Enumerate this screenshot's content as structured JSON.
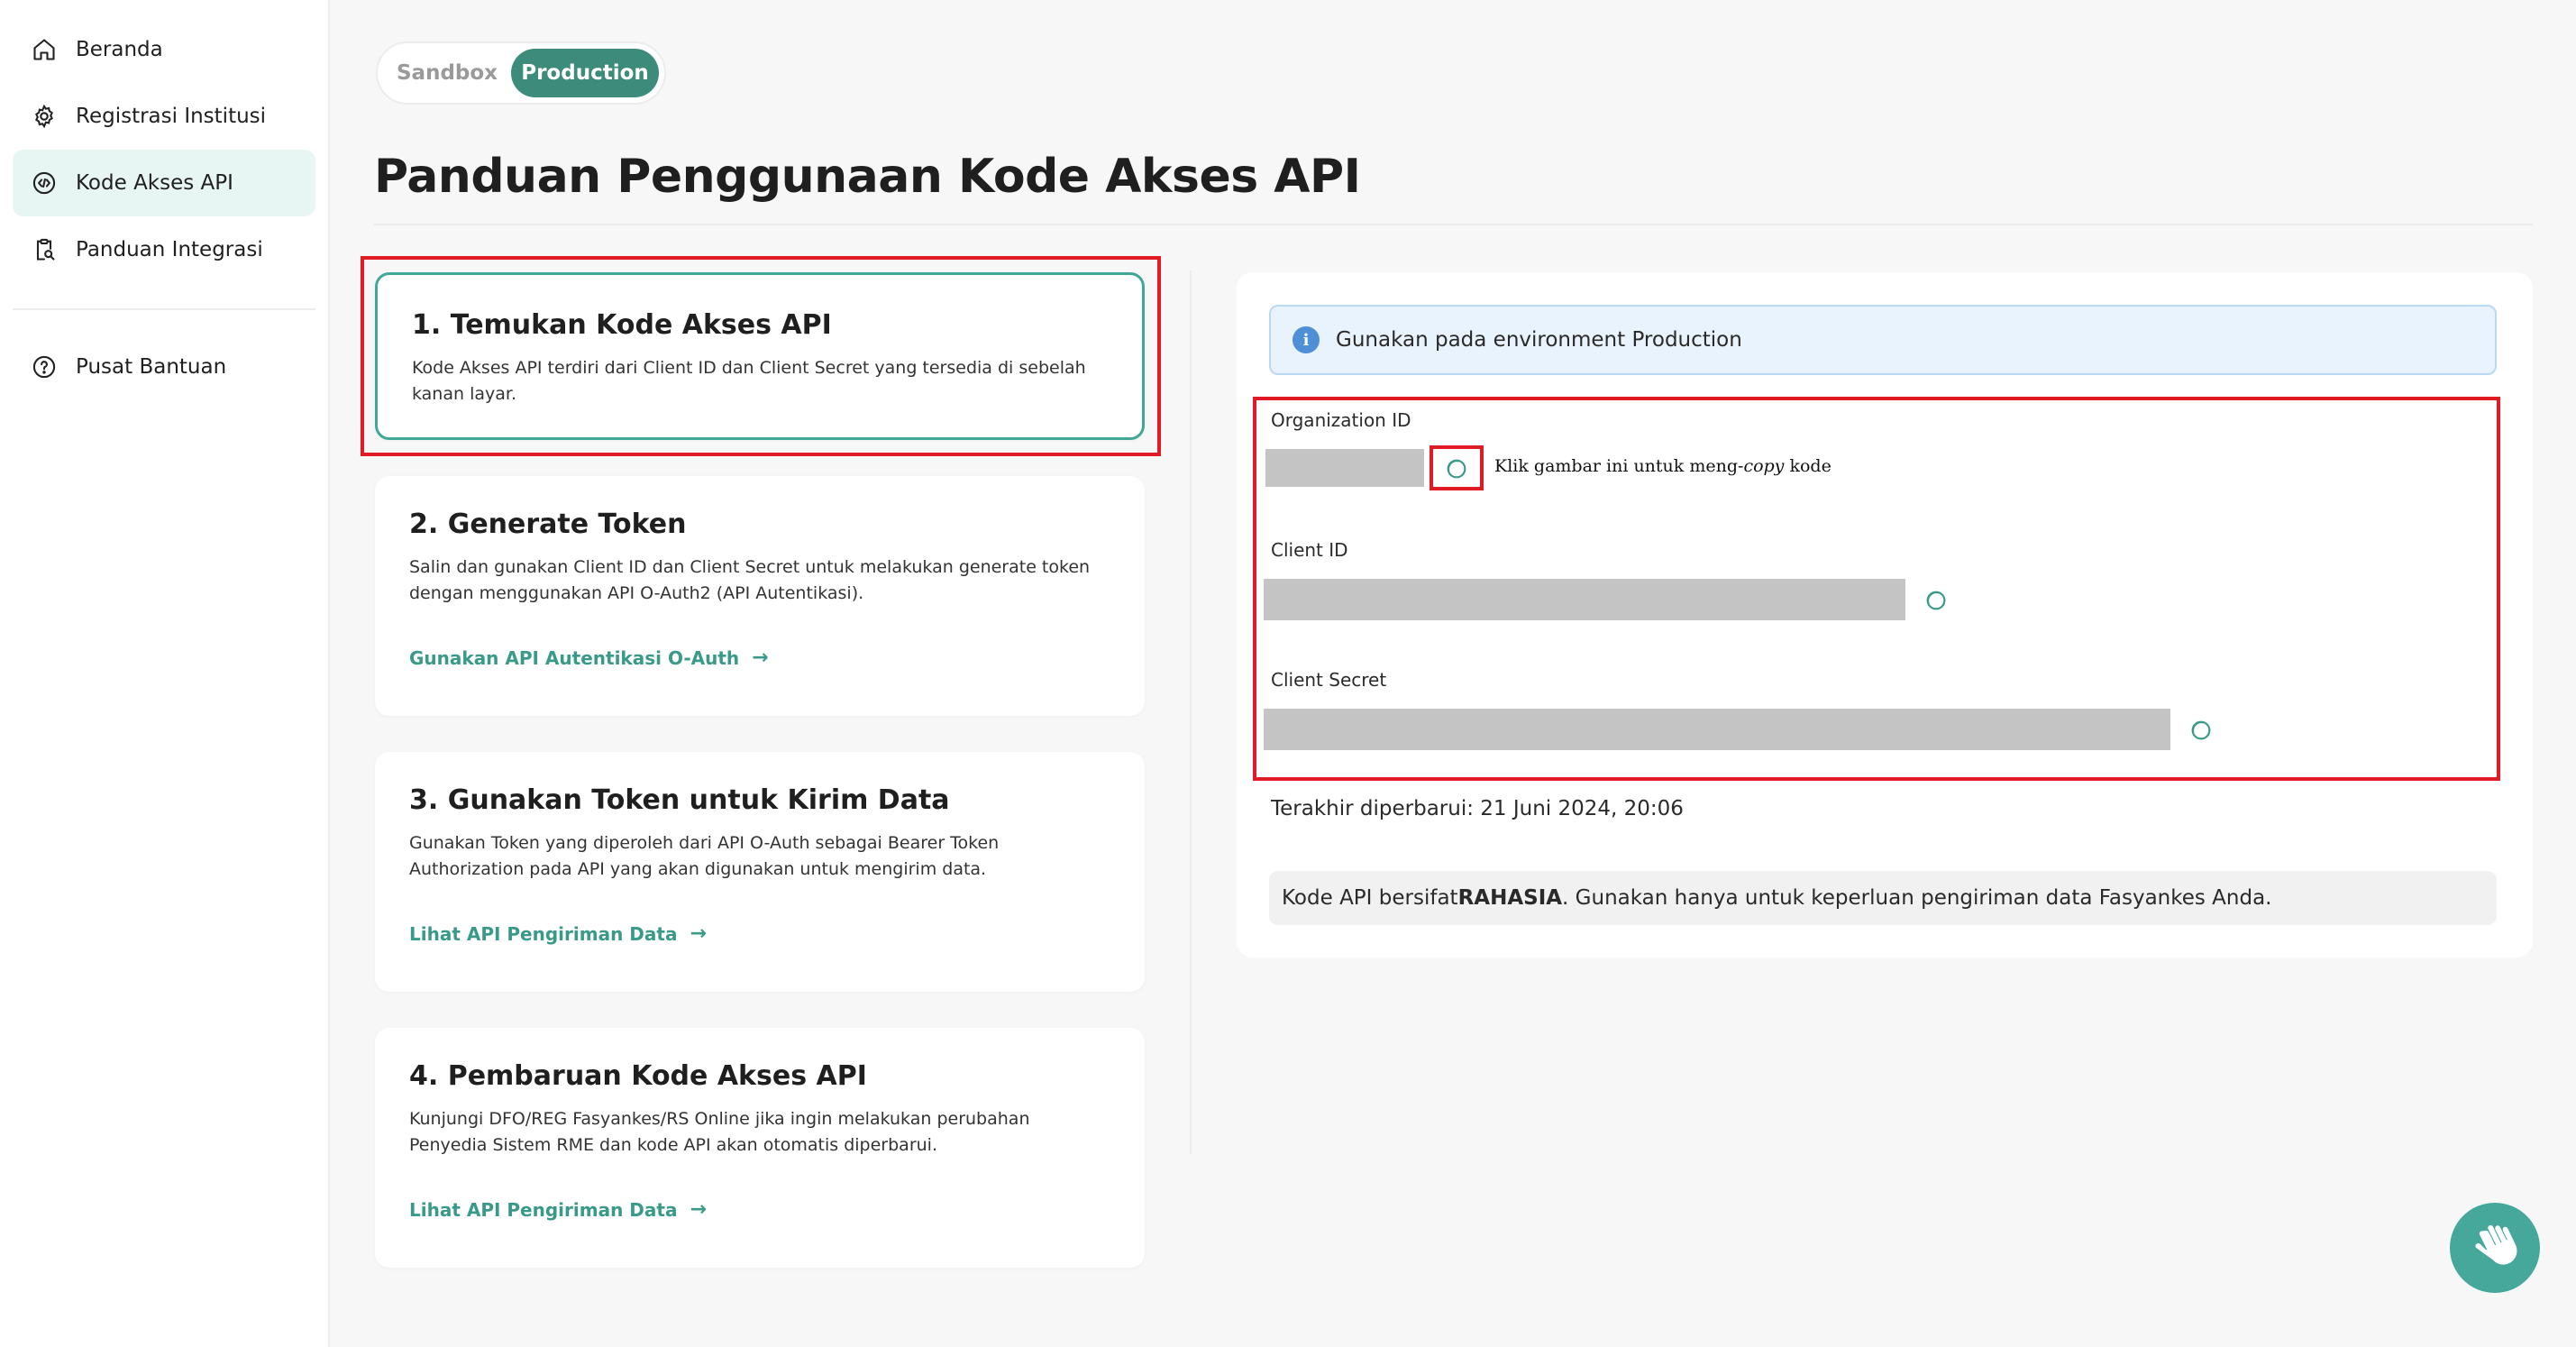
{
  "sidebar": {
    "items": [
      {
        "label": "Beranda",
        "icon": "home-icon"
      },
      {
        "label": "Registrasi Institusi",
        "icon": "gear-icon"
      },
      {
        "label": "Kode Akses API",
        "icon": "code-icon",
        "active": true
      },
      {
        "label": "Panduan Integrasi",
        "icon": "clipboard-search-icon"
      }
    ],
    "help_item": {
      "label": "Pusat Bantuan",
      "icon": "help-circle-icon"
    }
  },
  "env_toggle": {
    "sandbox_label": "Sandbox",
    "production_label": "Production",
    "selected": "Production"
  },
  "page": {
    "title": "Panduan Penggunaan Kode Akses API"
  },
  "steps": [
    {
      "title": "1. Temukan Kode Akses API",
      "description": "Kode Akses API terdiri dari Client ID dan Client Secret yang tersedia di sebelah kanan layar."
    },
    {
      "title": "2. Generate Token",
      "description": "Salin dan gunakan Client ID dan Client Secret untuk melakukan generate token dengan menggunakan API O-Auth2 (API Autentikasi).",
      "link": "Gunakan API Autentikasi O-Auth"
    },
    {
      "title": "3. Gunakan Token untuk Kirim Data",
      "description": "Gunakan Token yang diperoleh dari API O-Auth sebagai Bearer Token Authorization pada API yang akan digunakan untuk mengirim data.",
      "link": "Lihat API Pengiriman Data"
    },
    {
      "title": "4. Pembaruan Kode Akses API",
      "description": "Kunjungi DFO/REG Fasyankes/RS Online jika ingin melakukan perubahan Penyedia Sistem RME dan kode API akan otomatis diperbarui.",
      "link": "Lihat API Pengiriman Data"
    }
  ],
  "credentials": {
    "banner": "Gunakan pada environment Production",
    "organization_id_label": "Organization ID",
    "client_id_label": "Client ID",
    "client_secret_label": "Client Secret",
    "copy_hint_prefix": "Klik gambar ini untuk meng-",
    "copy_hint_italic": "copy",
    "copy_hint_suffix": " kode",
    "last_updated": "Terakhir diperbarui: 21 Juni 2024, 20:06",
    "secret_note_prefix": "Kode API bersifat ",
    "secret_note_bold": "RAHASIA",
    "secret_note_suffix": ". Gunakan hanya untuk keperluan pengiriman data Fasyankes Anda."
  },
  "colors": {
    "accent": "#3d8b7a",
    "link": "#3a9a89",
    "highlight_red": "#e01b24",
    "info_bg": "#e8f3fd"
  }
}
